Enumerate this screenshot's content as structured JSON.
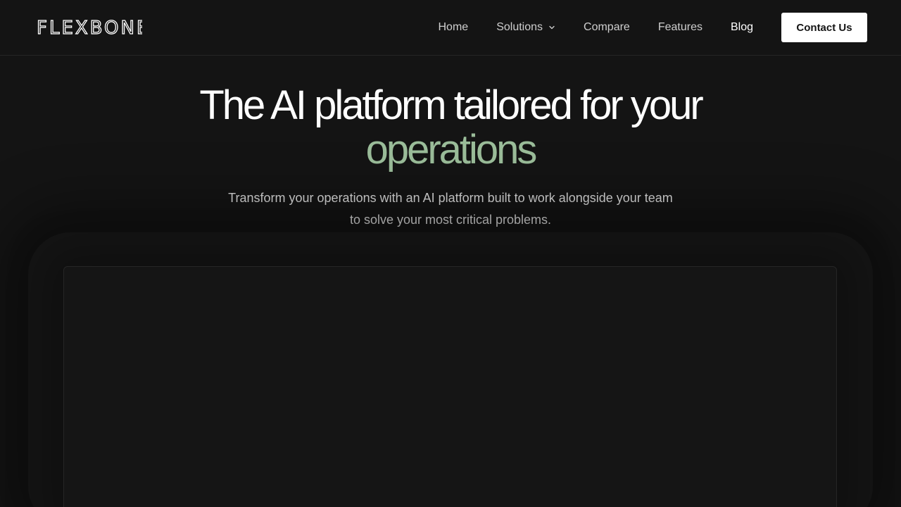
{
  "header": {
    "logo_text": "FLEXBONE",
    "nav": {
      "home": "Home",
      "solutions": "Solutions",
      "compare": "Compare",
      "features": "Features",
      "blog": "Blog"
    },
    "contact_label": "Contact Us"
  },
  "hero": {
    "title_line1": "The AI platform tailored for your",
    "title_accent": "operations",
    "subtitle": "Transform your operations with an AI platform built to work alongside your team to solve your most critical problems."
  },
  "colors": {
    "background": "#141414",
    "accent": "#9bbd9a",
    "button_bg": "#ffffff",
    "text": "#ffffff"
  }
}
